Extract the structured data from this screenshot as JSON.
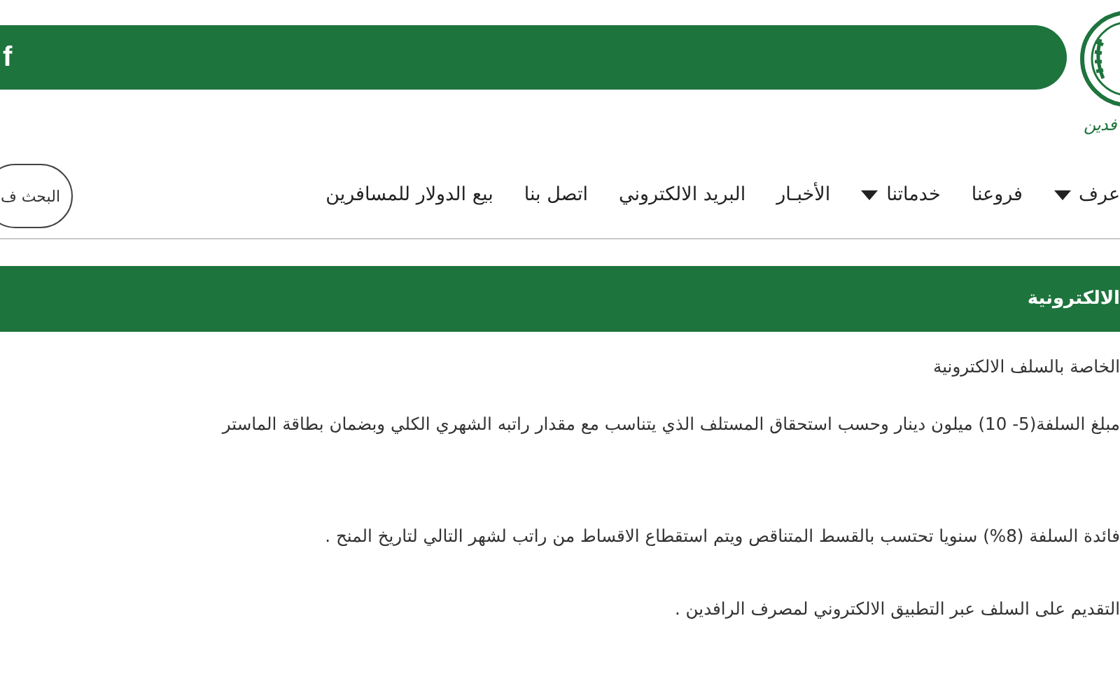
{
  "header": {
    "social_icon": "f",
    "logo_text": "فدين"
  },
  "nav": {
    "items": [
      {
        "label": "عرف",
        "kind": "dropdown"
      },
      {
        "label": "فروعنا",
        "kind": "link"
      },
      {
        "label": "خدماتنا",
        "kind": "dropdown"
      },
      {
        "label": "الأخبـار",
        "kind": "link"
      },
      {
        "label": "البريد الالكتروني",
        "kind": "link"
      },
      {
        "label": "اتصل بنا",
        "kind": "link"
      },
      {
        "label": "بيع الدولار للمسافرين",
        "kind": "link"
      }
    ],
    "search_button": "البحث ف"
  },
  "page_title": "الالكترونية",
  "paragraphs": [
    "الخاصة بالسلف الالكترونية",
    "مبلغ السلفة(5- 10) ميلون دينار وحسب استحقاق المستلف الذي يتناسب مع مقدار راتبه الشهري الكلي وبضمان بطاقة الماستر",
    "فائدة السلفة (8%) سنويا تحتسب بالقسط المتناقص ويتم استقطاع الاقساط من راتب لشهر التالي لتاريخ المنح .",
    "التقديم على السلف عبر التطبيق الالكتروني لمصرف الرافدين ."
  ]
}
